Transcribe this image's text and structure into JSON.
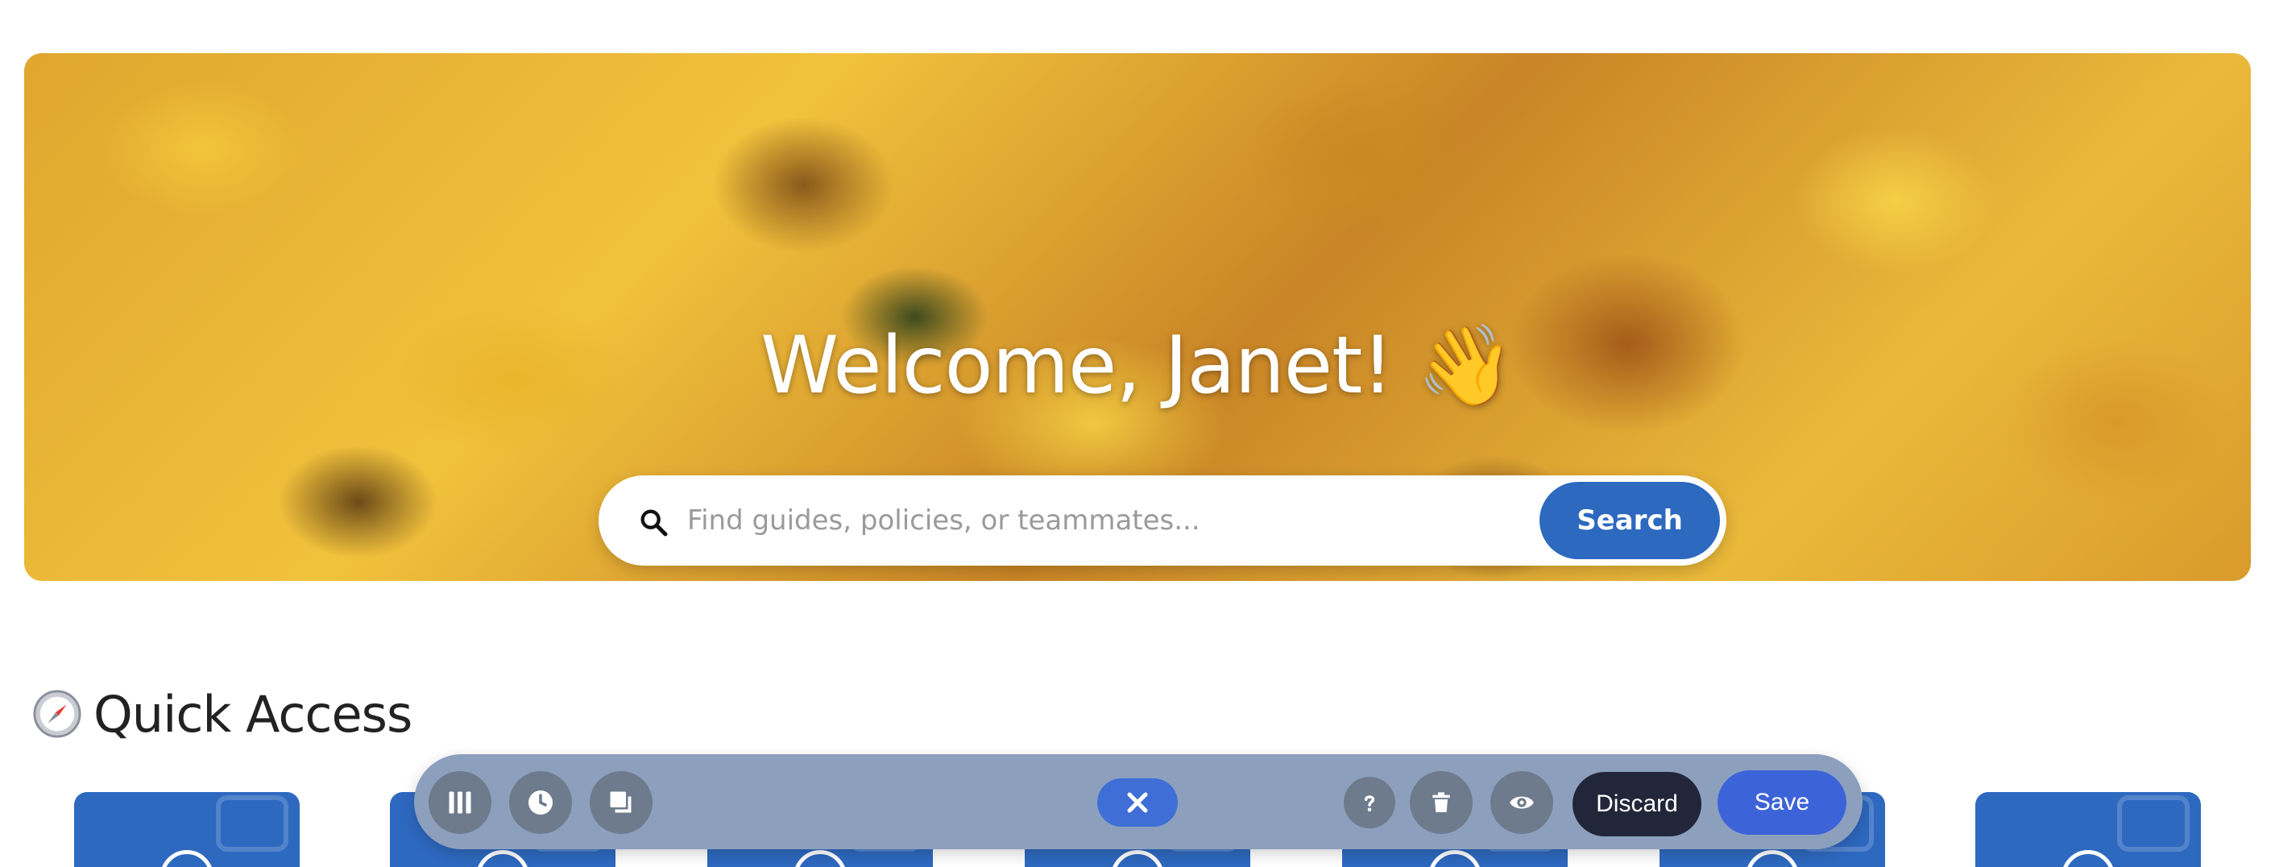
{
  "hero": {
    "title": "Welcome, Janet! 👋",
    "search_placeholder": "Find guides, policies, or teammates...",
    "search_button_label": "Search"
  },
  "quick_access": {
    "title": "Quick Access",
    "title_icon": "compass-icon"
  },
  "toolbar": {
    "left_buttons": [
      {
        "icon": "columns-icon"
      },
      {
        "icon": "clock-icon"
      },
      {
        "icon": "duplicate-icon"
      }
    ],
    "center_button": {
      "icon": "close-icon"
    },
    "right_icon_buttons": [
      {
        "icon": "help-icon"
      },
      {
        "icon": "trash-icon"
      },
      {
        "icon": "eye-icon"
      }
    ],
    "discard_label": "Discard",
    "save_label": "Save"
  },
  "colors": {
    "primary_blue": "#2d69bf",
    "toolbar_bg": "#8ca0bd",
    "discard_bg": "#22263a",
    "save_bg": "#3d63d8"
  }
}
